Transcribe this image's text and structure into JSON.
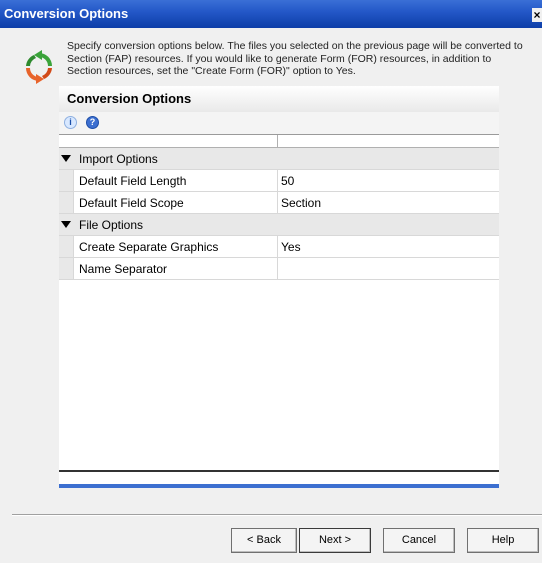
{
  "window": {
    "title": "Conversion Options"
  },
  "header": {
    "description": "Specify conversion options below.  The files you selected on the previous page will be converted to Section (FAP) resources.  If you would like to generate Form (FOR) resources, in addition to Section resources, set the \"Create Form (FOR)\" option to Yes."
  },
  "panel": {
    "title": "Conversion Options",
    "tools": {
      "info_icon": "i",
      "help_icon": "?"
    }
  },
  "grid": {
    "categories": [
      {
        "name": "Import Options"
      },
      {
        "name": "File Options"
      }
    ],
    "rows": [
      {
        "name": "Default Field Length",
        "value": "50"
      },
      {
        "name": "Default Field Scope",
        "value": "Section"
      },
      {
        "name": "Create Separate Graphics",
        "value": "Yes"
      },
      {
        "name": "Name Separator",
        "value": ""
      }
    ]
  },
  "buttons": {
    "back": "< Back",
    "next": "Next >",
    "cancel": "Cancel",
    "help": "Help"
  },
  "colors": {
    "title_bar": "#2458c8",
    "accent_bar": "#3c6fd0",
    "category_bg": "#e8e8e8"
  }
}
